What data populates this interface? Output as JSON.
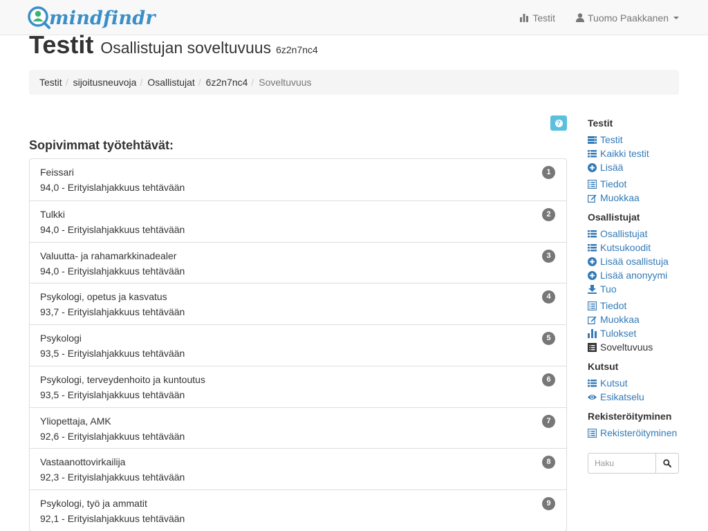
{
  "brand": {
    "name": "mindfindr"
  },
  "nav": {
    "tests_label": "Testit",
    "user_label": "Tuomo Paakkanen"
  },
  "header": {
    "title": "Testit",
    "subtitle": "Osallistujan soveltuvuus",
    "code": "6z2n7nc4"
  },
  "breadcrumb": [
    "Testit",
    "sijoitusneuvoja",
    "Osallistujat",
    "6z2n7nc4",
    "Soveltuvuus"
  ],
  "help": {
    "icon": "question-circle-icon"
  },
  "section_title": "Sopivimmat työtehtävät:",
  "jobs": [
    {
      "title": "Feissari",
      "score": "94,0 - Erityislahjakkuus tehtävään",
      "rank": "1"
    },
    {
      "title": "Tulkki",
      "score": "94,0 - Erityislahjakkuus tehtävään",
      "rank": "2"
    },
    {
      "title": "Valuutta- ja rahamarkkinadealer",
      "score": "94,0 - Erityislahjakkuus tehtävään",
      "rank": "3"
    },
    {
      "title": "Psykologi, opetus ja kasvatus",
      "score": "93,7 - Erityislahjakkuus tehtävään",
      "rank": "4"
    },
    {
      "title": "Psykologi",
      "score": "93,5 - Erityislahjakkuus tehtävään",
      "rank": "5"
    },
    {
      "title": "Psykologi, terveydenhoito ja kuntoutus",
      "score": "93,5 - Erityislahjakkuus tehtävään",
      "rank": "6"
    },
    {
      "title": "Yliopettaja, AMK",
      "score": "92,6 - Erityislahjakkuus tehtävään",
      "rank": "7"
    },
    {
      "title": "Vastaanottovirkailija",
      "score": "92,3 - Erityislahjakkuus tehtävään",
      "rank": "8"
    },
    {
      "title": "Psykologi, työ ja ammatit",
      "score": "92,1 - Erityislahjakkuus tehtävään",
      "rank": "9"
    }
  ],
  "sidebar": {
    "tests": {
      "heading": "Testit",
      "links": [
        "Testit",
        "Kaikki testit",
        "Lisää",
        "Tiedot",
        "Muokkaa"
      ]
    },
    "participants": {
      "heading": "Osallistujat",
      "links": [
        "Osallistujat",
        "Kutsukoodit",
        "Lisää osallistuja",
        "Lisää anonyymi",
        "Tuo",
        "Tiedot",
        "Muokkaa",
        "Tulokset",
        "Soveltuvuus"
      ]
    },
    "invites": {
      "heading": "Kutsut",
      "links": [
        "Kutsut",
        "Esikatselu"
      ]
    },
    "registration": {
      "heading": "Rekisteröityminen",
      "links": [
        "Rekisteröityminen"
      ]
    }
  },
  "search": {
    "placeholder": "Haku"
  },
  "colors": {
    "link": "#337ab7",
    "badge": "#777777",
    "info": "#5bc0de",
    "brand": "#3a8fc9",
    "brand_green": "#3cb371"
  }
}
